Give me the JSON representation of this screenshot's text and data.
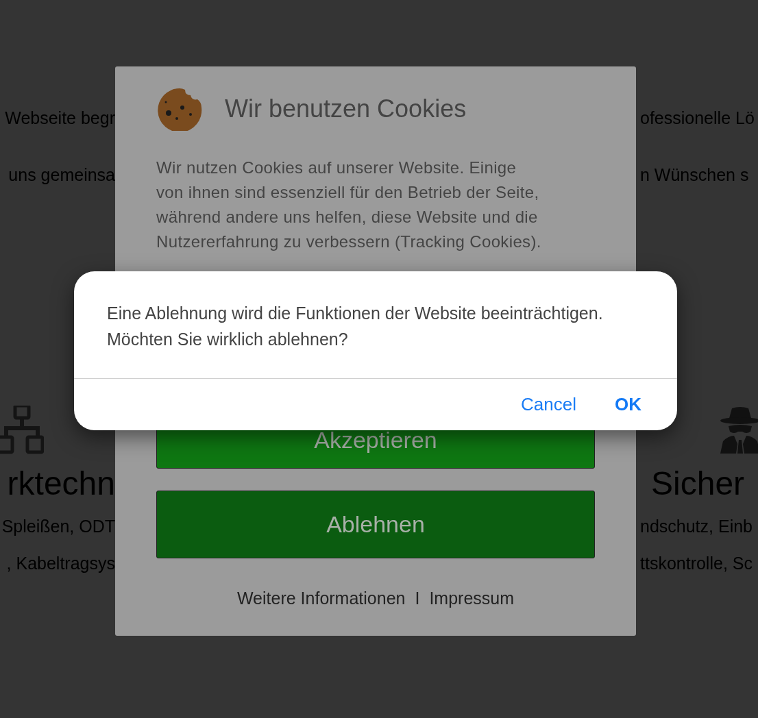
{
  "page": {
    "left": {
      "lines": [
        "Webseite begr",
        "uns gemeinsa"
      ],
      "heading": "rktechn",
      "details": [
        "Spleißen, ODT",
        ", Kabeltragsys"
      ]
    },
    "right": {
      "lines": [
        "ofessionelle Lö",
        "n Wünschen s"
      ],
      "heading": "Sicher",
      "details": [
        "ndschutz, Einb",
        "ttskontrolle, Sc"
      ]
    }
  },
  "cookie_banner": {
    "title": "Wir benutzen Cookies",
    "text": "Wir nutzen Cookies auf unserer Website. Einige von ihnen sind essenziell für den Betrieb der Seite, während andere uns helfen, diese Website und die Nutzererfahrung zu verbessern (Tracking Cookies).",
    "buttons": [
      {
        "label": "Akzeptieren",
        "kind": "accept"
      },
      {
        "label": "Ablehnen",
        "kind": "decline"
      }
    ],
    "links": [
      "Weitere Informationen",
      "Impressum"
    ],
    "separator": "I"
  },
  "alert": {
    "message": "Eine Ablehnung wird die Funktionen der Website beeinträchtigen. Möchten Sie wirklich ablehnen?",
    "buttons": [
      {
        "label": "Cancel",
        "kind": "cancel"
      },
      {
        "label": "OK",
        "kind": "confirm"
      }
    ]
  }
}
